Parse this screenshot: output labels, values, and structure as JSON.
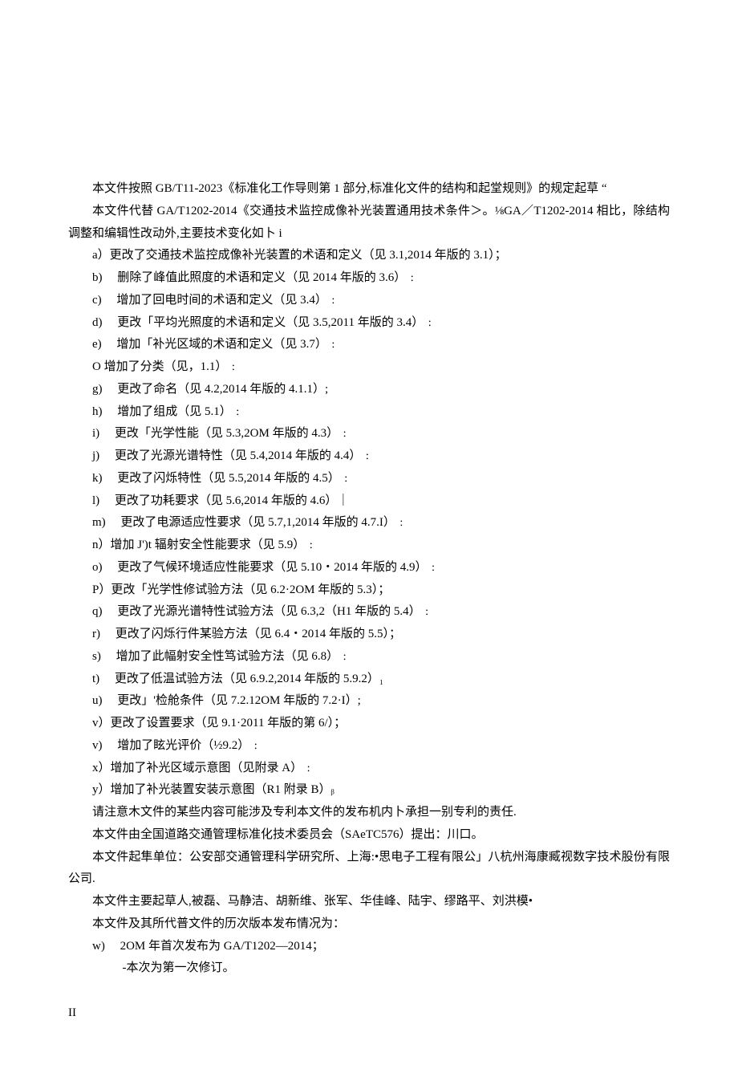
{
  "p1": "本文件按照 GB/T11-2023《标准化工作导则第 1 部分,标准化文件的结构和起堂规则》的规定起草 “",
  "p2": "本文件代替 GA/T1202-2014《交通技术监控成像补光装置通用技术条件＞。⅛GA／T1202-2014 相比，除结构调整和编辑性改动外,主要技术变化如卜 i",
  "items": [
    "a）更改了交通技术监控成像补光装置的术语和定义（见 3.1,2014 年版的 3.1）；",
    "b)　 删除了峰值此照度的术语和定义（见 2014 年版的 3.6）﹕",
    "c)　 增加了回电时间的术语和定义（见 3.4）﹕",
    "d)　 更改「平均光照度的术语和定义（见 3.5,2011 年版的 3.4）﹕",
    "e)　 增加「补光区域的术语和定义（见 3.7）﹕",
    "O 增加了分类（见，1.1）﹕",
    "g)　 更改了命名（见 4.2,2014 年版的 4.1.1）;",
    "h)　 增加了组成（见 5.1）﹕",
    "i)　 更改「光学性能（见 5.3,2OM 年版的 4.3）﹕",
    "j)　 更改了光源光谱特性（见 5.4,2014 年版的 4.4）﹕",
    "k)　 更改了闪烁特性（见 5.5,2014 年版的 4.5）﹕",
    "l)　 更改了功耗要求（见 5.6,2014 年版的 4.6）｜",
    "m)　 更改了电源适应性要求（见 5.7,1,2014 年版的 4.7.I）﹕",
    "n）增加 J')t 辐射安全性能要求（见 5.9）﹕",
    "o)　 更改了气候环境适应性能要求（见 5.10・2014 年版的 4.9）﹕",
    "P）更改「光学性修试验方法（见 6.2·2OM 年版的 5.3）；",
    "q)　 更改了光源光谱特性试验方法（见 6.3,2（H1 年版的 5.4）﹕",
    "r)　 更改了闪烁行件某验方法（见 6.4・2014 年版的 5.5）；",
    "s)　 增加了此幅射安全性笃试验方法（见 6.8）﹕",
    "t)　 更改了低温试验方法（见 6.9.2,2014 年版的 5.9.2）₁",
    "u)　 更改」'检舱条件（见 7.2.12OM 年版的 7.2·I）;",
    "v）更改了设置要求（见 9.1·2011 年版的第 6/）；",
    "v)　 增加了眩光评价（½9.2）﹕",
    "x）增加了补光区域示意图（见附录 A）﹕",
    "y）增加了补光装置安装示意图（R1 附录 B）ᵦ"
  ],
  "p3": "请注意木文件的某些内容可能涉及专利本文件的发布机内卜承担一别专利的责任.",
  "p4": "本文件由全国道路交通管理标准化技术委员会（SAeTC576）提出：川口。",
  "p5": "本文件起隼单位：公安部交通管理科学研究所、上海:•思电子工程有限公」八杭州海康臧视数字技术股份有限公司.",
  "p6": "本文件主要起草人,被磊、马静洁、胡新维、张军、华佳峰、陆宇、缪路平、刘洪模•",
  "p7": "本文件及其所代普文件的历次版本发布情况为：",
  "w_item": "w)　  2OM 年首次发布为 GA/T1202—2014；",
  "w_sub": "-本次为第一次修订。",
  "page_number": "II"
}
